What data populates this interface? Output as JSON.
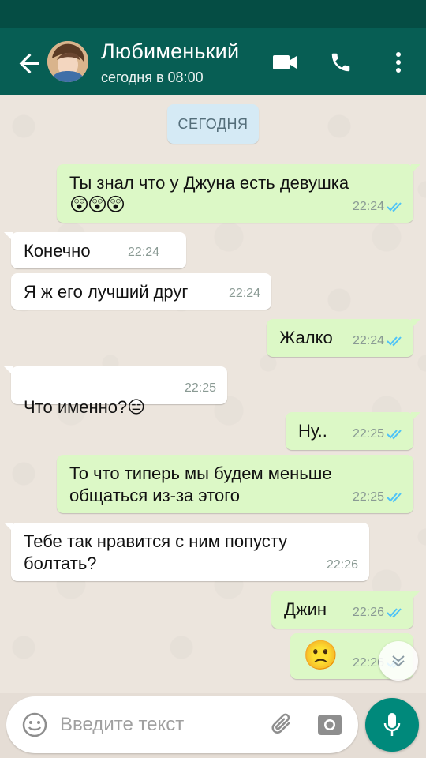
{
  "header": {
    "title": "Любименький",
    "status": "сегодня в 08:00"
  },
  "chat": {
    "day_label": "СЕГОДНЯ",
    "messages": [
      {
        "dir": "out",
        "text": "Ты знал что у Джуна есть девушка",
        "emoji": "😲😲😲",
        "time": "22:24",
        "read": true
      },
      {
        "dir": "in",
        "text": "Конечно",
        "time": "22:24"
      },
      {
        "dir": "in",
        "text": "Я ж его лучший друг",
        "time": "22:24"
      },
      {
        "dir": "out",
        "text": "Жалко",
        "time": "22:24",
        "read": true
      },
      {
        "dir": "in",
        "text": "Что именно?",
        "emoji": "😑",
        "time": "22:25"
      },
      {
        "dir": "out",
        "text": "Ну..",
        "time": "22:25",
        "read": true
      },
      {
        "dir": "out",
        "text": "То что типерь мы будем меньше\nобщаться из-за этого",
        "time": "22:25",
        "read": true
      },
      {
        "dir": "in",
        "text": "Тебе так нравится с ним попусту\nболтать?",
        "time": "22:26"
      },
      {
        "dir": "out",
        "text": "Джин",
        "time": "22:26",
        "read": true
      },
      {
        "dir": "out",
        "text": "",
        "emoji": "🙁",
        "time": "22:26",
        "read": true
      }
    ]
  },
  "composer": {
    "placeholder": "Введите текст"
  },
  "colors": {
    "appbar": "#075e54",
    "statusbar": "#054d44",
    "outgoing": "#dcf8c6",
    "incoming": "#ffffff",
    "read_ticks": "#4fc3f7",
    "mic_button": "#00897b"
  },
  "icons": [
    "back-arrow-icon",
    "video-call-icon",
    "phone-icon",
    "more-vert-icon",
    "emoji-icon",
    "attach-icon",
    "camera-icon",
    "mic-icon",
    "chevron-down-icon",
    "double-check-icon"
  ]
}
